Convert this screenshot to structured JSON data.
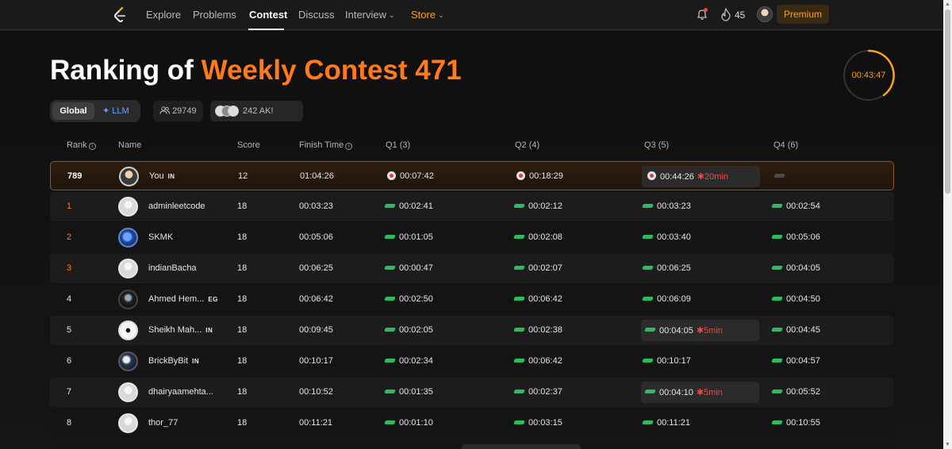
{
  "nav": {
    "items": [
      "Explore",
      "Problems",
      "Contest",
      "Discuss",
      "Interview",
      "Store"
    ],
    "streak": "45",
    "premium": "Premium"
  },
  "header": {
    "title_prefix": "Ranking of ",
    "title_accent": "Weekly Contest 471",
    "timer": "00:43:47"
  },
  "filters": {
    "global": "Global",
    "llm": "✦ LLM",
    "participants": "29749",
    "ak_count": "242 AK!"
  },
  "columns": {
    "rank": "Rank",
    "name": "Name",
    "score": "Score",
    "finish": "Finish Time",
    "q1": "Q1 (3)",
    "q2": "Q2 (4)",
    "q3": "Q3 (5)",
    "q4": "Q4 (6)"
  },
  "rows": [
    {
      "rank": "789",
      "name": "You",
      "flag": "IN",
      "score": "12",
      "finish": "01:04:26",
      "q1": "00:07:42",
      "q2": "00:18:29",
      "q3": "00:44:26",
      "q3_penalty": "✱20min",
      "q4": ""
    },
    {
      "rank": "1",
      "name": "adminleetcode",
      "flag": "",
      "score": "18",
      "finish": "00:03:23",
      "q1": "00:02:41",
      "q2": "00:02:12",
      "q3": "00:03:23",
      "q3_penalty": "",
      "q4": "00:02:54"
    },
    {
      "rank": "2",
      "name": "SKMK",
      "flag": "",
      "score": "18",
      "finish": "00:05:06",
      "q1": "00:01:05",
      "q2": "00:02:08",
      "q3": "00:03:40",
      "q3_penalty": "",
      "q4": "00:05:06"
    },
    {
      "rank": "3",
      "name": "indianBacha",
      "flag": "",
      "score": "18",
      "finish": "00:06:25",
      "q1": "00:00:47",
      "q2": "00:02:07",
      "q3": "00:06:25",
      "q3_penalty": "",
      "q4": "00:04:05"
    },
    {
      "rank": "4",
      "name": "Ahmed Hem...",
      "flag": "EG",
      "score": "18",
      "finish": "00:06:42",
      "q1": "00:02:50",
      "q2": "00:06:42",
      "q3": "00:06:09",
      "q3_penalty": "",
      "q4": "00:04:50"
    },
    {
      "rank": "5",
      "name": "Sheikh Mah...",
      "flag": "IN",
      "score": "18",
      "finish": "00:09:45",
      "q1": "00:02:05",
      "q2": "00:02:38",
      "q3": "00:04:05",
      "q3_penalty": "✱5min",
      "q4": "00:04:45"
    },
    {
      "rank": "6",
      "name": "BrickByBit",
      "flag": "IN",
      "score": "18",
      "finish": "00:10:17",
      "q1": "00:02:34",
      "q2": "00:06:42",
      "q3": "00:10:17",
      "q3_penalty": "",
      "q4": "00:04:57"
    },
    {
      "rank": "7",
      "name": "dhairyaamehta...",
      "flag": "",
      "score": "18",
      "finish": "00:10:52",
      "q1": "00:01:35",
      "q2": "00:02:37",
      "q3": "00:04:10",
      "q3_penalty": "✱5min",
      "q4": "00:05:52"
    },
    {
      "rank": "8",
      "name": "thor_77",
      "flag": "",
      "score": "18",
      "finish": "00:11:21",
      "q1": "00:01:10",
      "q2": "00:03:15",
      "q3": "00:11:21",
      "q3_penalty": "",
      "q4": "00:10:55"
    }
  ],
  "colors": {
    "accent": "#ffa116",
    "title_accent": "#ff7a1a",
    "accepted": "#2cbb5d",
    "penalty": "#ef4743"
  }
}
